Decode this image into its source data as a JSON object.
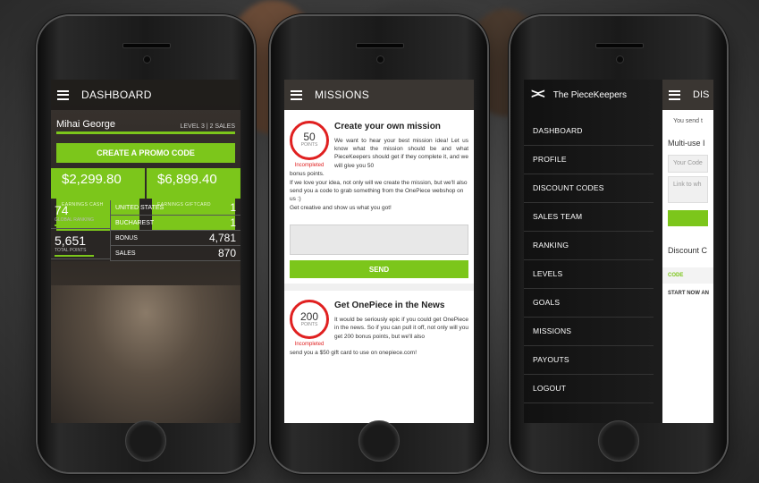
{
  "dashboard": {
    "title": "DASHBOARD",
    "user_name": "Mihai George",
    "level_info": "LEVEL 3  |  2 SALES",
    "promo_button": "CREATE A PROMO CODE",
    "earnings_cash_value": "$2,299.80",
    "earnings_cash_label": "EARNINGS CASH",
    "earnings_gift_value": "$6,899.40",
    "earnings_gift_label": "EARNINGS GIFTCARD",
    "global_ranking_value": "74",
    "global_ranking_label": "GLOBAL RANKING",
    "total_points_value": "5,651",
    "total_points_label": "TOTAL POINTS",
    "rows": [
      {
        "label": "UNITED STATES",
        "value": "1"
      },
      {
        "label": "BUCHAREST",
        "value": "1"
      },
      {
        "label": "BONUS",
        "value": "4,781"
      },
      {
        "label": "SALES",
        "value": "870"
      }
    ]
  },
  "missions": {
    "title": "MISSIONS",
    "mission1": {
      "points": "50",
      "points_label": "POINTS",
      "status": "Incompleted",
      "heading": "Create your own mission",
      "intro": "We want to hear your best mission idea! Let us know what the mission should be and what PieceKeepers should get if they complete it, and we will give you 50",
      "continued": "bonus points.",
      "para2": "If we love your idea, not only will we create the mission, but we'll also send you a code to grab something from the OnePiece webshop on us :)",
      "para3": "Get creative and show us what you got!",
      "send": "SEND"
    },
    "mission2": {
      "points": "200",
      "points_label": "POINTS",
      "status": "Incompleted",
      "heading": "Get OnePiece in the News",
      "intro": "It would be seriously epic if you could get OnePiece in the news. So if you can pull it off, not only will you get 200 bonus points, but we'll also",
      "continued": "send you a $50 gift card to use on onepiece.com!"
    }
  },
  "menu": {
    "brand": "The PieceKeepers",
    "items": [
      "DASHBOARD",
      "PROFILE",
      "DISCOUNT CODES",
      "SALES TEAM",
      "RANKING",
      "LEVELS",
      "GOALS",
      "MISSIONS",
      "PAYOUTS",
      "LOGOUT"
    ],
    "peek": {
      "header": "DIS",
      "text": "You send t",
      "section": "Multi-use I",
      "input1": "Your Code",
      "input2": "Link to wh",
      "section2": "Discount C",
      "code_col": "CODE",
      "start_now": "START NOW AN"
    }
  }
}
